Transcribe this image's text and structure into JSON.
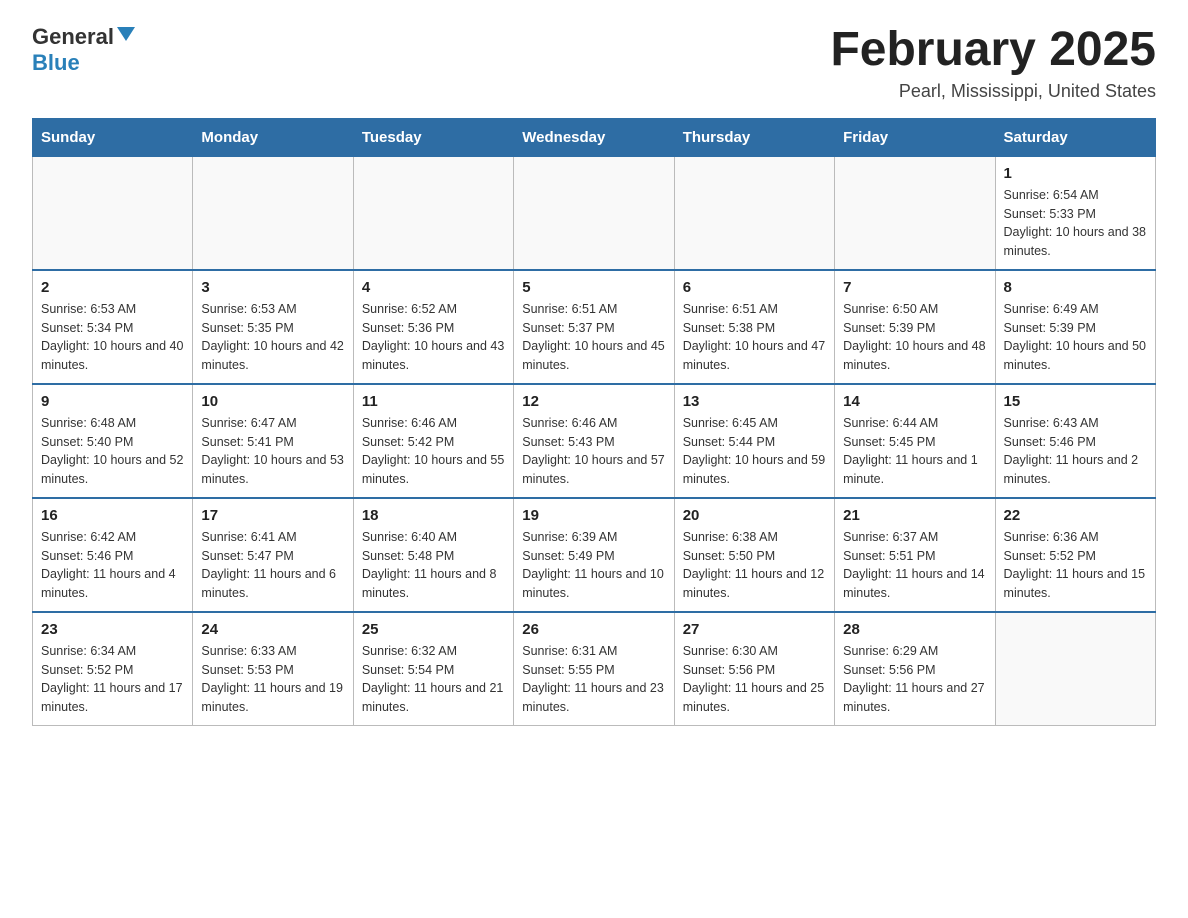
{
  "header": {
    "logo_general": "General",
    "logo_blue": "Blue",
    "title": "February 2025",
    "subtitle": "Pearl, Mississippi, United States"
  },
  "weekdays": [
    "Sunday",
    "Monday",
    "Tuesday",
    "Wednesday",
    "Thursday",
    "Friday",
    "Saturday"
  ],
  "weeks": [
    [
      {
        "day": "",
        "sunrise": "",
        "sunset": "",
        "daylight": ""
      },
      {
        "day": "",
        "sunrise": "",
        "sunset": "",
        "daylight": ""
      },
      {
        "day": "",
        "sunrise": "",
        "sunset": "",
        "daylight": ""
      },
      {
        "day": "",
        "sunrise": "",
        "sunset": "",
        "daylight": ""
      },
      {
        "day": "",
        "sunrise": "",
        "sunset": "",
        "daylight": ""
      },
      {
        "day": "",
        "sunrise": "",
        "sunset": "",
        "daylight": ""
      },
      {
        "day": "1",
        "sunrise": "Sunrise: 6:54 AM",
        "sunset": "Sunset: 5:33 PM",
        "daylight": "Daylight: 10 hours and 38 minutes."
      }
    ],
    [
      {
        "day": "2",
        "sunrise": "Sunrise: 6:53 AM",
        "sunset": "Sunset: 5:34 PM",
        "daylight": "Daylight: 10 hours and 40 minutes."
      },
      {
        "day": "3",
        "sunrise": "Sunrise: 6:53 AM",
        "sunset": "Sunset: 5:35 PM",
        "daylight": "Daylight: 10 hours and 42 minutes."
      },
      {
        "day": "4",
        "sunrise": "Sunrise: 6:52 AM",
        "sunset": "Sunset: 5:36 PM",
        "daylight": "Daylight: 10 hours and 43 minutes."
      },
      {
        "day": "5",
        "sunrise": "Sunrise: 6:51 AM",
        "sunset": "Sunset: 5:37 PM",
        "daylight": "Daylight: 10 hours and 45 minutes."
      },
      {
        "day": "6",
        "sunrise": "Sunrise: 6:51 AM",
        "sunset": "Sunset: 5:38 PM",
        "daylight": "Daylight: 10 hours and 47 minutes."
      },
      {
        "day": "7",
        "sunrise": "Sunrise: 6:50 AM",
        "sunset": "Sunset: 5:39 PM",
        "daylight": "Daylight: 10 hours and 48 minutes."
      },
      {
        "day": "8",
        "sunrise": "Sunrise: 6:49 AM",
        "sunset": "Sunset: 5:39 PM",
        "daylight": "Daylight: 10 hours and 50 minutes."
      }
    ],
    [
      {
        "day": "9",
        "sunrise": "Sunrise: 6:48 AM",
        "sunset": "Sunset: 5:40 PM",
        "daylight": "Daylight: 10 hours and 52 minutes."
      },
      {
        "day": "10",
        "sunrise": "Sunrise: 6:47 AM",
        "sunset": "Sunset: 5:41 PM",
        "daylight": "Daylight: 10 hours and 53 minutes."
      },
      {
        "day": "11",
        "sunrise": "Sunrise: 6:46 AM",
        "sunset": "Sunset: 5:42 PM",
        "daylight": "Daylight: 10 hours and 55 minutes."
      },
      {
        "day": "12",
        "sunrise": "Sunrise: 6:46 AM",
        "sunset": "Sunset: 5:43 PM",
        "daylight": "Daylight: 10 hours and 57 minutes."
      },
      {
        "day": "13",
        "sunrise": "Sunrise: 6:45 AM",
        "sunset": "Sunset: 5:44 PM",
        "daylight": "Daylight: 10 hours and 59 minutes."
      },
      {
        "day": "14",
        "sunrise": "Sunrise: 6:44 AM",
        "sunset": "Sunset: 5:45 PM",
        "daylight": "Daylight: 11 hours and 1 minute."
      },
      {
        "day": "15",
        "sunrise": "Sunrise: 6:43 AM",
        "sunset": "Sunset: 5:46 PM",
        "daylight": "Daylight: 11 hours and 2 minutes."
      }
    ],
    [
      {
        "day": "16",
        "sunrise": "Sunrise: 6:42 AM",
        "sunset": "Sunset: 5:46 PM",
        "daylight": "Daylight: 11 hours and 4 minutes."
      },
      {
        "day": "17",
        "sunrise": "Sunrise: 6:41 AM",
        "sunset": "Sunset: 5:47 PM",
        "daylight": "Daylight: 11 hours and 6 minutes."
      },
      {
        "day": "18",
        "sunrise": "Sunrise: 6:40 AM",
        "sunset": "Sunset: 5:48 PM",
        "daylight": "Daylight: 11 hours and 8 minutes."
      },
      {
        "day": "19",
        "sunrise": "Sunrise: 6:39 AM",
        "sunset": "Sunset: 5:49 PM",
        "daylight": "Daylight: 11 hours and 10 minutes."
      },
      {
        "day": "20",
        "sunrise": "Sunrise: 6:38 AM",
        "sunset": "Sunset: 5:50 PM",
        "daylight": "Daylight: 11 hours and 12 minutes."
      },
      {
        "day": "21",
        "sunrise": "Sunrise: 6:37 AM",
        "sunset": "Sunset: 5:51 PM",
        "daylight": "Daylight: 11 hours and 14 minutes."
      },
      {
        "day": "22",
        "sunrise": "Sunrise: 6:36 AM",
        "sunset": "Sunset: 5:52 PM",
        "daylight": "Daylight: 11 hours and 15 minutes."
      }
    ],
    [
      {
        "day": "23",
        "sunrise": "Sunrise: 6:34 AM",
        "sunset": "Sunset: 5:52 PM",
        "daylight": "Daylight: 11 hours and 17 minutes."
      },
      {
        "day": "24",
        "sunrise": "Sunrise: 6:33 AM",
        "sunset": "Sunset: 5:53 PM",
        "daylight": "Daylight: 11 hours and 19 minutes."
      },
      {
        "day": "25",
        "sunrise": "Sunrise: 6:32 AM",
        "sunset": "Sunset: 5:54 PM",
        "daylight": "Daylight: 11 hours and 21 minutes."
      },
      {
        "day": "26",
        "sunrise": "Sunrise: 6:31 AM",
        "sunset": "Sunset: 5:55 PM",
        "daylight": "Daylight: 11 hours and 23 minutes."
      },
      {
        "day": "27",
        "sunrise": "Sunrise: 6:30 AM",
        "sunset": "Sunset: 5:56 PM",
        "daylight": "Daylight: 11 hours and 25 minutes."
      },
      {
        "day": "28",
        "sunrise": "Sunrise: 6:29 AM",
        "sunset": "Sunset: 5:56 PM",
        "daylight": "Daylight: 11 hours and 27 minutes."
      },
      {
        "day": "",
        "sunrise": "",
        "sunset": "",
        "daylight": ""
      }
    ]
  ]
}
